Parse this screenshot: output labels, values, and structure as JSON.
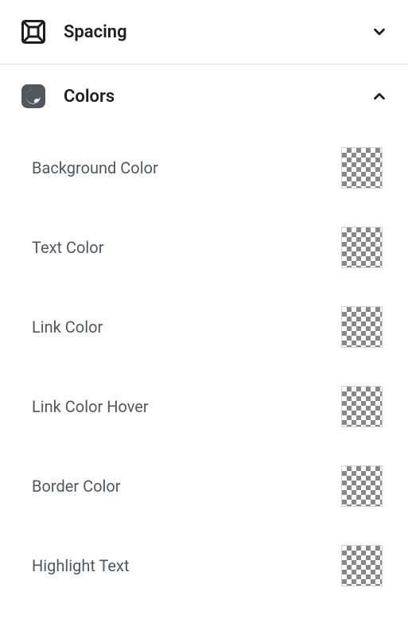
{
  "sections": {
    "spacing": {
      "title": "Spacing",
      "expanded": false
    },
    "colors": {
      "title": "Colors",
      "expanded": true,
      "items": [
        {
          "label": "Background Color"
        },
        {
          "label": "Text Color"
        },
        {
          "label": "Link Color"
        },
        {
          "label": "Link Color Hover"
        },
        {
          "label": "Border Color"
        },
        {
          "label": "Highlight Text"
        }
      ]
    }
  }
}
